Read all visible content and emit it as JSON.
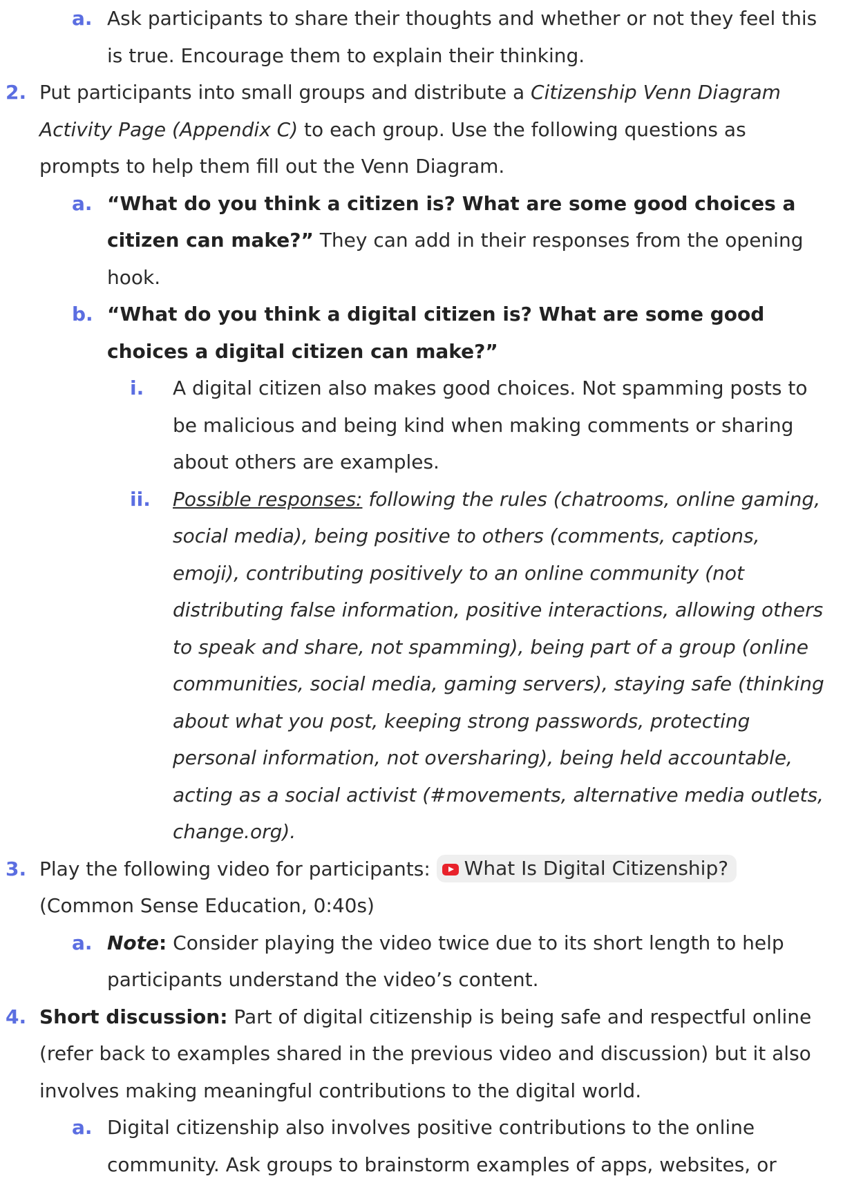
{
  "list": {
    "item1": {
      "sub_a": {
        "marker": "a.",
        "text": "Ask participants to share their thoughts and whether or not they feel this is true. Encourage them to explain their thinking."
      }
    },
    "item2": {
      "marker": "2.",
      "text_pre": "Put participants into small groups and distribute a ",
      "text_italic": "Citizenship Venn Diagram Activity Page (Appendix C)",
      "text_post": " to each group. Use the following questions as prompts to help them fill out the Venn Diagram.",
      "sub_a": {
        "marker": "a.",
        "bold": "“What do you think a citizen is? What are some good choices a citizen can make?”",
        "text": " They can add in their responses from the opening hook."
      },
      "sub_b": {
        "marker": "b.",
        "bold": "“What do you think a digital citizen is? What are some good choices a digital citizen can make?”",
        "sub_i": {
          "marker": "i.",
          "text": "A digital citizen also makes good choices. Not spamming posts to be malicious and being kind when making comments or sharing about others are examples."
        },
        "sub_ii": {
          "marker": "ii.",
          "underline": "Possible responses:",
          "italic": " following the rules (chatrooms, online gaming, social media), being positive to others (comments, captions, emoji), contributing positively to an online community (not distributing false information, positive interactions, allowing others to speak and share, not spamming), being part of a group (online communities, social media, gaming servers), staying safe (thinking about what you post, keeping strong passwords, protecting personal information, not oversharing), being held accountable, acting as a social activist (#movements, alternative media outlets, change.org)."
        }
      }
    },
    "item3": {
      "marker": "3.",
      "text_pre": "Play the following video for participants: ",
      "video_link": "What Is Digital Citizenship?",
      "text_post": " (Common Sense Education, 0:40s)",
      "sub_a": {
        "marker": "a.",
        "note_label": "Note",
        "note_colon": ":",
        "text": " Consider playing the video twice due to its short length to help participants understand the video’s content."
      }
    },
    "item4": {
      "marker": "4.",
      "bold": "Short discussion:",
      "text": " Part of digital citizenship is being safe and respectful online (refer back to examples shared in the previous video and discussion) but it also involves making meaningful contributions to the digital world.",
      "sub_a": {
        "marker": "a.",
        "text": "Digital citizenship also involves positive contributions to the online community. Ask groups to brainstorm examples of apps, websites, or"
      }
    }
  },
  "icons": {
    "video": "youtube-play-icon"
  },
  "colors": {
    "marker": "#5b6ee1",
    "video_icon": "#e8222b",
    "chip_bg": "#efefef"
  }
}
